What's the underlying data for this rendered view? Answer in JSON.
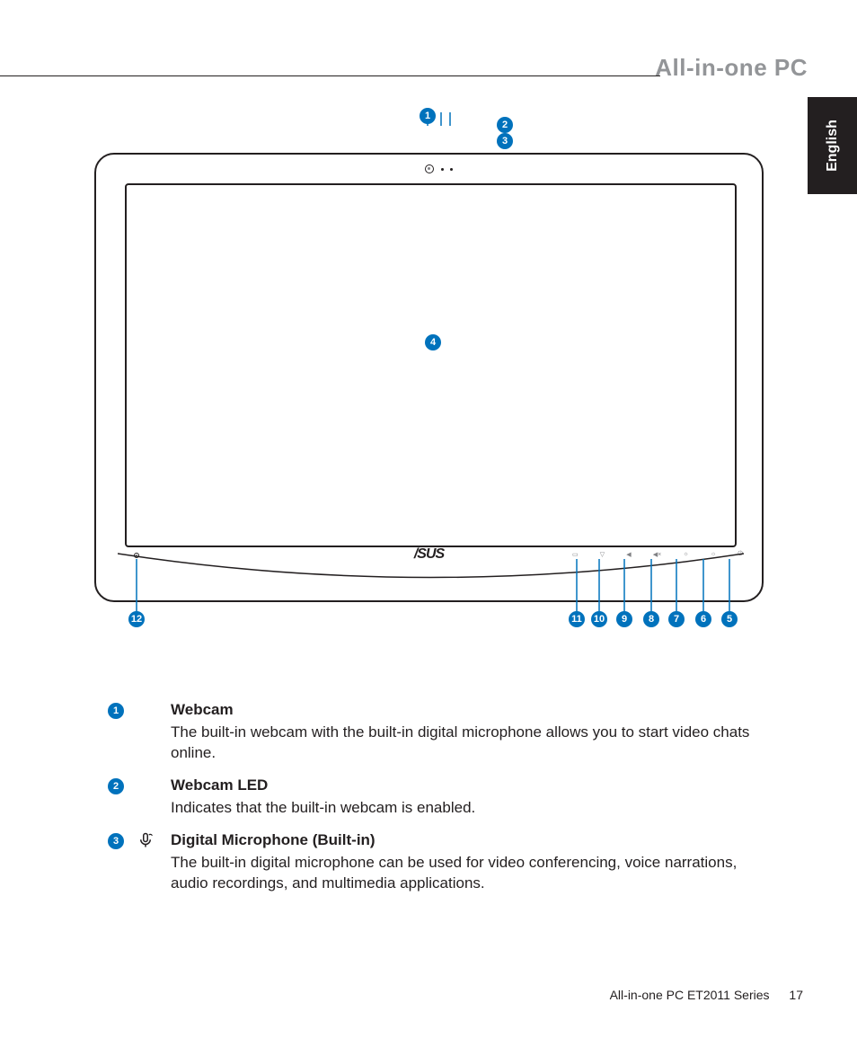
{
  "header": {
    "title": "All-in-one PC"
  },
  "language_tab": "English",
  "logo_text": "/SUS",
  "diagram_callouts": {
    "c1": "1",
    "c2": "2",
    "c3": "3",
    "c4": "4",
    "c5": "5",
    "c6": "6",
    "c7": "7",
    "c8": "8",
    "c9": "9",
    "c10": "10",
    "c11": "11",
    "c12": "12"
  },
  "descriptions": [
    {
      "num": "1",
      "icon": "",
      "title": "Webcam",
      "text": "The built-in webcam with the built-in digital microphone allows you to start video chats online."
    },
    {
      "num": "2",
      "icon": "",
      "title": "Webcam LED",
      "text": "Indicates that the built-in webcam is enabled."
    },
    {
      "num": "3",
      "icon": "mic",
      "title": "Digital Microphone (Built-in)",
      "text": "The built-in digital microphone can be used for video conferencing, voice narrations, audio recordings, and multimedia applications."
    }
  ],
  "footer": {
    "series": "All-in-one PC ET2011 Series",
    "page": "17"
  }
}
